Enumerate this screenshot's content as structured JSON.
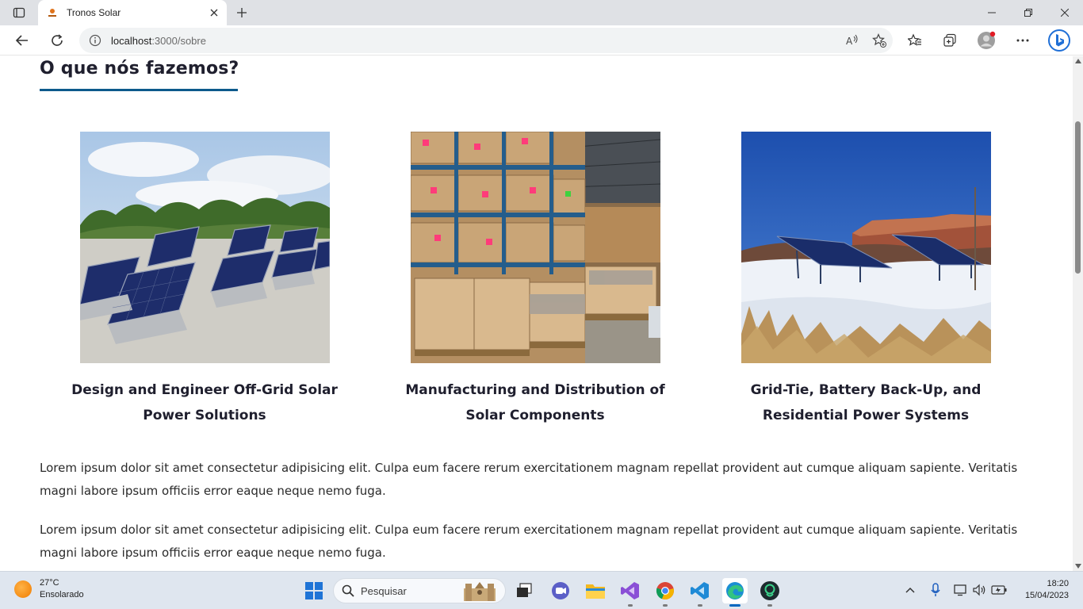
{
  "browser": {
    "tab_title": "Tronos Solar",
    "url_host": "localhost",
    "url_path": ":3000/sobre"
  },
  "page": {
    "section_title": "O que nós fazemos?",
    "cards": [
      {
        "title_line1": "Design and Engineer Off-Grid Solar",
        "title_line2": "Power Solutions"
      },
      {
        "title_line1": "Manufacturing and Distribution of",
        "title_line2": "Solar Components"
      },
      {
        "title_line1": "Grid-Tie, Battery Back-Up, and",
        "title_line2": "Residential Power Systems"
      }
    ],
    "paragraphs": [
      "Lorem ipsum dolor sit amet consectetur adipisicing elit. Culpa eum facere rerum exercitationem magnam repellat provident aut cumque aliquam sapiente. Veritatis magni labore ipsum officiis error eaque neque nemo fuga.",
      "Lorem ipsum dolor sit amet consectetur adipisicing elit. Culpa eum facere rerum exercitationem magnam repellat provident aut cumque aliquam sapiente. Veritatis magni labore ipsum officiis error eaque neque nemo fuga."
    ],
    "accent_color": "#0d5a8c"
  },
  "taskbar": {
    "weather_temp": "27°C",
    "weather_desc": "Ensolarado",
    "search_placeholder": "Pesquisar",
    "time": "18:20",
    "date": "15/04/2023"
  }
}
